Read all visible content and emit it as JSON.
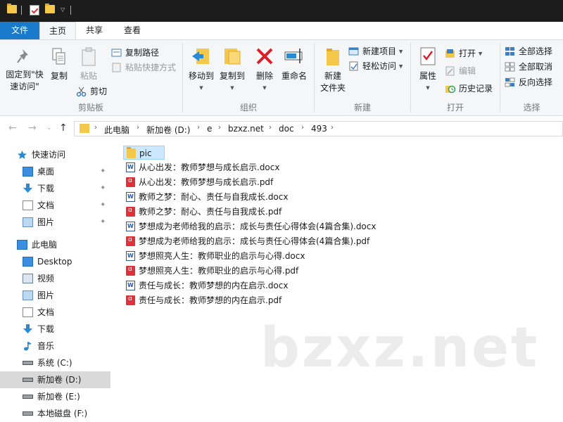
{
  "ribbon_tabs": {
    "file": "文件",
    "home": "主页",
    "share": "共享",
    "view": "查看"
  },
  "ribbon": {
    "clipboard": {
      "label": "剪贴板",
      "pin_quick": "固定到\"快",
      "pin_quick2": "速访问\"",
      "copy": "复制",
      "paste": "粘贴",
      "copy_path": "复制路径",
      "paste_shortcut": "粘贴快捷方式",
      "cut": "剪切"
    },
    "organize": {
      "label": "组织",
      "move_to": "移动到",
      "copy_to": "复制到",
      "delete": "删除",
      "rename": "重命名"
    },
    "new": {
      "label": "新建",
      "new_folder": "新建",
      "new_folder2": "文件夹",
      "new_item": "新建项目",
      "easy_access": "轻松访问"
    },
    "open": {
      "label": "打开",
      "properties": "属性",
      "open": "打开",
      "edit": "编辑",
      "history": "历史记录"
    },
    "select": {
      "label": "选择",
      "select_all": "全部选择",
      "select_none": "全部取消",
      "invert": "反向选择"
    }
  },
  "address": {
    "crumbs": [
      "此电脑",
      "新加卷 (D:)",
      "e",
      "bzxz.net",
      "doc",
      "493"
    ]
  },
  "sidebar": {
    "quick_access": "快速访问",
    "quick_items": [
      "桌面",
      "下载",
      "文档",
      "图片"
    ],
    "this_pc": "此电脑",
    "pc_items": [
      "Desktop",
      "视频",
      "图片",
      "文档",
      "下载",
      "音乐",
      "系统 (C:)",
      "新加卷 (D:)",
      "新加卷 (E:)",
      "本地磁盘 (F:)"
    ]
  },
  "files": [
    {
      "name": "pic",
      "type": "folder"
    },
    {
      "name": "从心出发：教师梦想与成长启示.docx",
      "type": "docx"
    },
    {
      "name": "从心出发：教师梦想与成长启示.pdf",
      "type": "pdf"
    },
    {
      "name": "教师之梦：耐心、责任与自我成长.docx",
      "type": "docx"
    },
    {
      "name": "教师之梦：耐心、责任与自我成长.pdf",
      "type": "pdf"
    },
    {
      "name": "梦想成为老师给我的启示：成长与责任心得体会(4篇合集).docx",
      "type": "docx"
    },
    {
      "name": "梦想成为老师给我的启示：成长与责任心得体会(4篇合集).pdf",
      "type": "pdf"
    },
    {
      "name": "梦想照亮人生：教师职业的启示与心得.docx",
      "type": "docx"
    },
    {
      "name": "梦想照亮人生：教师职业的启示与心得.pdf",
      "type": "pdf"
    },
    {
      "name": "责任与成长：教师梦想的内在启示.docx",
      "type": "docx"
    },
    {
      "name": "责任与成长：教师梦想的内在启示.pdf",
      "type": "pdf"
    }
  ],
  "watermark": "bzxz.net"
}
